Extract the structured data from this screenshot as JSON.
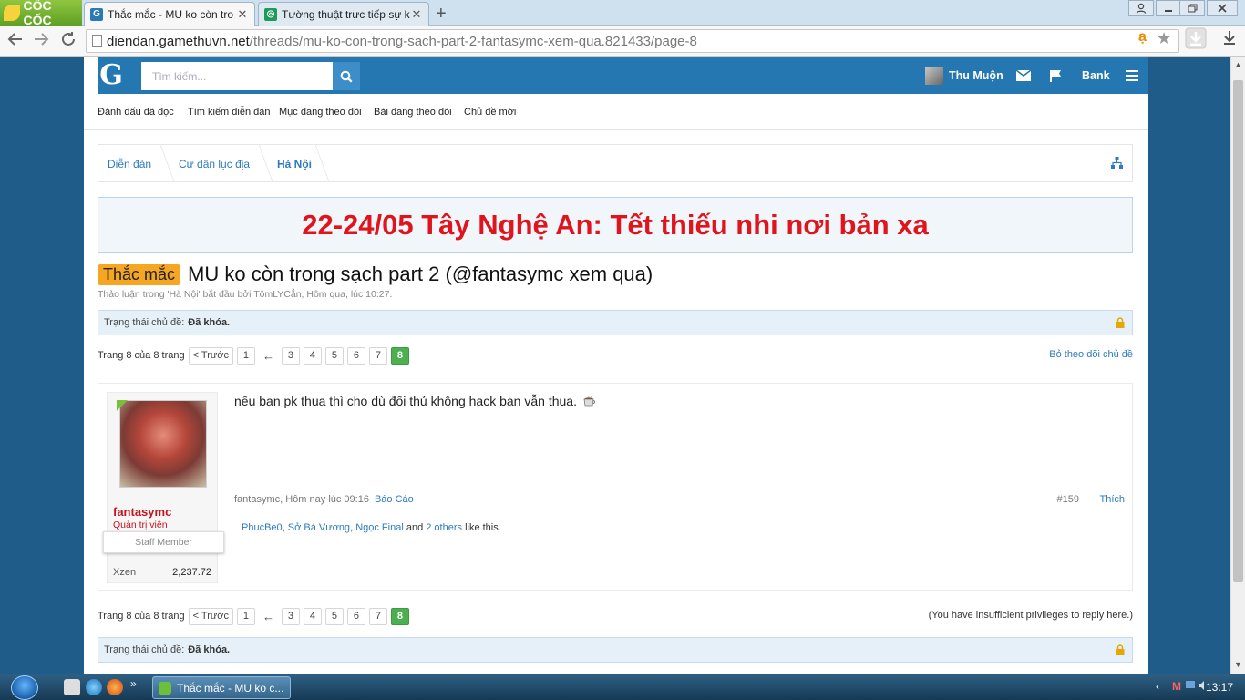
{
  "browser": {
    "brand": "CỐC CỐC",
    "tabs": [
      {
        "title": "Thắc mắc - MU ko còn tro",
        "favicon": "G",
        "color": "#2a7ab8"
      },
      {
        "title": "Tường thuật trực tiếp sự ki",
        "favicon": "◎",
        "color": "#1d9a5c"
      }
    ],
    "new_tab": "+",
    "url_host": "diendan.gamethuvn.net",
    "url_path": "/threads/mu-ko-con-trong-sach-part-2-fantasymc-xem-qua.821433/page-8"
  },
  "header": {
    "logo": "G",
    "search_placeholder": "Tìm kiếm...",
    "username": "Thu Muộn",
    "bank": "Bank"
  },
  "subnav": [
    "Đánh dấu đã đọc",
    "Tìm kiếm diễn đàn",
    "Mục đang theo dõi",
    "Bài đang theo dõi",
    "Chủ đề mới"
  ],
  "breadcrumb": [
    "Diễn đàn",
    "Cư dân lục địa",
    "Hà Nội"
  ],
  "banner": "22-24/05 Tây Nghệ An: Tết thiếu nhi nơi bản xa",
  "thread": {
    "prefix": "Thắc mắc",
    "title": "MU ko còn trong sạch part 2 (@fantasymc xem qua)",
    "meta": "Thảo luận trong 'Hà Nội' bắt đầu bởi TômLYCẳn, Hôm qua, lúc 10:27.",
    "status_label": "Trạng thái chủ đề:",
    "status_value": "Đã khóa.",
    "unwatch": "Bỏ theo dõi chủ đề",
    "no_reply": "(You have insufficient privileges to reply here.)"
  },
  "pagination": {
    "label": "Trang 8 của 8 trang",
    "prev": "< Trước",
    "first": "1",
    "arrow": "←",
    "pages": [
      "3",
      "4",
      "5",
      "6",
      "7"
    ],
    "current": "8"
  },
  "post": {
    "user": "fantasymc",
    "user_title": "Quản trị viên",
    "badge": "Staff Member",
    "xzen_label": "Xzen",
    "xzen_value": "2,237.72",
    "message": "nếu bạn pk thua thì cho dù đối thủ không hack bạn vẫn thua.",
    "meta": "fantasymc, Hôm nay lúc 09:16",
    "report": "Báo Cáo",
    "number": "#159",
    "like": "Thích",
    "likers": [
      "PhucBe0",
      "Sở Bá Vương",
      "Ngọc Final"
    ],
    "others": "2 others",
    "and": "and",
    "like_suffix": "like this."
  },
  "taskbar": {
    "task_title": "Thắc mắc - MU ko c...",
    "clock": "13:17"
  },
  "colors": {
    "header_blue": "#2577b1",
    "banner_red": "#e0141c",
    "current_page_green": "#4caf50",
    "user_red": "#c2141c",
    "link_blue": "#2e7bbf"
  }
}
